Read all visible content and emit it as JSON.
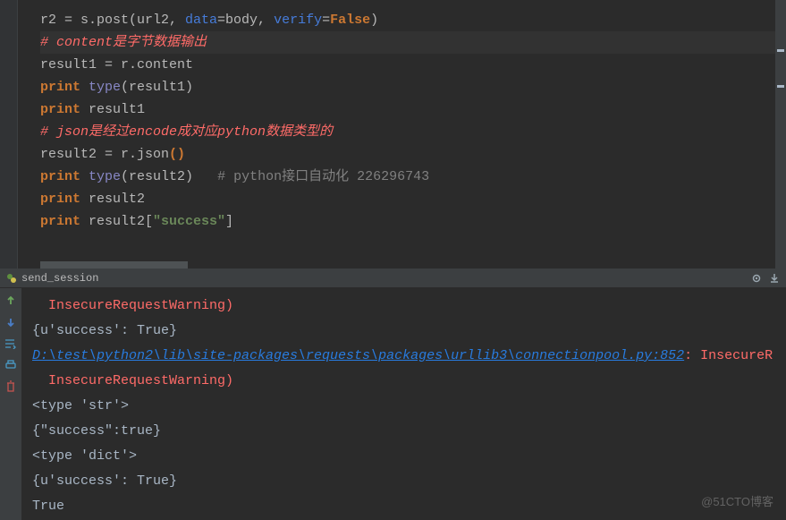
{
  "editor": {
    "lines": {
      "l1_a": "r2 = s.post(url2, ",
      "l1_b": "data",
      "l1_c": "=body, ",
      "l1_d": "verify",
      "l1_e": "=",
      "l1_f": "False",
      "l1_g": ")",
      "l2": "# content是字节数据输出",
      "l3": "result1 = r.content",
      "l4_a": "print",
      "l4_b": " ",
      "l4_c": "type",
      "l4_d": "(result1)",
      "l5_a": "print",
      "l5_b": " result1",
      "l6": "",
      "l7": "# json是经过encode成对应python数据类型的",
      "l8_a": "result2 = r.json()",
      "l8_b": "",
      "l9_a": "print",
      "l9_b": " ",
      "l9_c": "type",
      "l9_d": "(result2)   ",
      "l9_e": "# python接口自动化 226296743",
      "l10_a": "print",
      "l10_b": " result2",
      "l11_a": "print",
      "l11_b": " result2[",
      "l11_c": "\"success\"",
      "l11_d": "]"
    }
  },
  "tab": {
    "label": "send_session"
  },
  "output": {
    "l1": "  InsecureRequestWarning)",
    "l2": "{u'success': True}",
    "l3_path": "D:\\test\\python2\\lib\\site-packages\\requests\\packages\\urllib3\\connectionpool.py:852",
    "l3_rest": ": InsecureR",
    "l4": "  InsecureRequestWarning)",
    "l5": "<type 'str'>",
    "l6": "{\"success\":true}",
    "l7": "<type 'dict'>",
    "l8": "{u'success': True}",
    "l9": "True"
  },
  "watermark": "@51CTO博客"
}
